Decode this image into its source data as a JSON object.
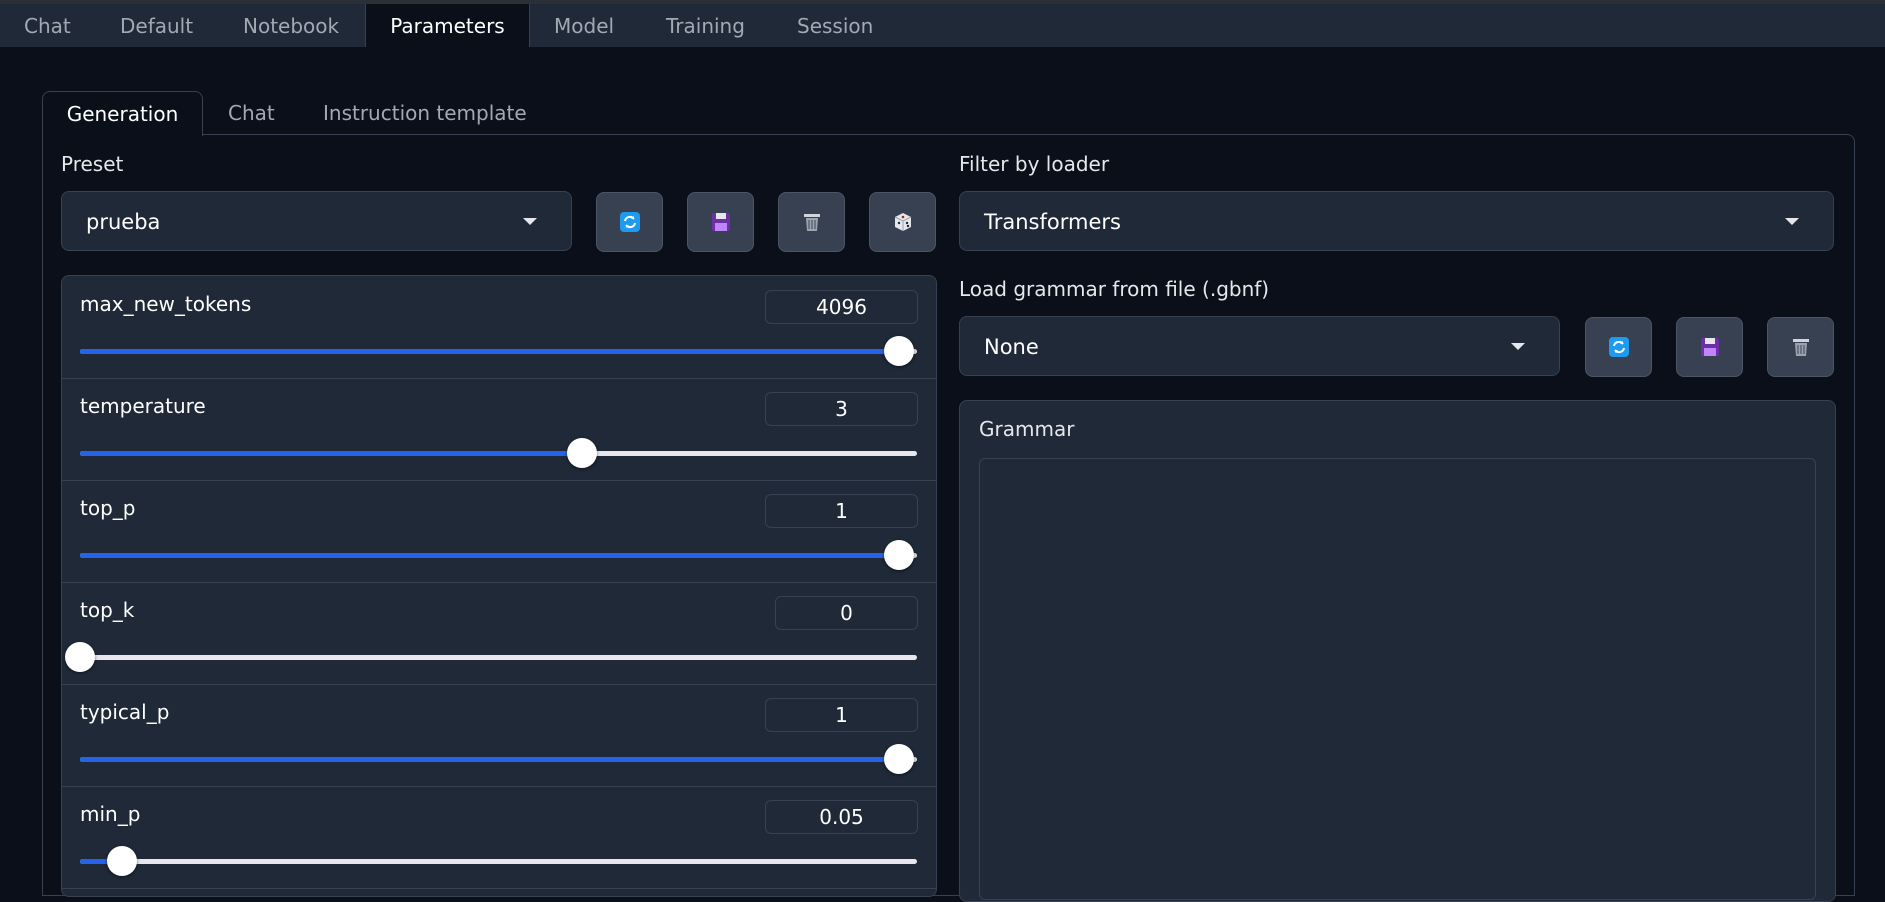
{
  "main_tabs": [
    "Chat",
    "Default",
    "Notebook",
    "Parameters",
    "Model",
    "Training",
    "Session"
  ],
  "active_main_tab": "Parameters",
  "sub_tabs": [
    "Generation",
    "Chat",
    "Instruction template"
  ],
  "active_sub_tab": "Generation",
  "preset": {
    "label": "Preset",
    "value": "prueba",
    "buttons": [
      "refresh-icon",
      "save-icon",
      "delete-icon",
      "random-icon"
    ]
  },
  "loader_filter": {
    "label": "Filter by loader",
    "value": "Transformers"
  },
  "grammar_file": {
    "label": "Load grammar from file (.gbnf)",
    "value": "None",
    "buttons": [
      "refresh-icon",
      "save-icon",
      "delete-icon"
    ]
  },
  "grammar": {
    "label": "Grammar",
    "value": ""
  },
  "sliders": [
    {
      "name": "max_new_tokens",
      "value": "4096",
      "fraction": 0.979
    },
    {
      "name": "temperature",
      "value": "3",
      "fraction": 0.6
    },
    {
      "name": "top_p",
      "value": "1",
      "fraction": 0.979
    },
    {
      "name": "top_k",
      "value": "0",
      "fraction": 0.0
    },
    {
      "name": "typical_p",
      "value": "1",
      "fraction": 0.979
    },
    {
      "name": "min_p",
      "value": "0.05",
      "fraction": 0.05
    }
  ],
  "colors": {
    "accent": "#2563eb",
    "background": "#0b0f19",
    "panel": "#1f2937",
    "border": "#374151"
  }
}
